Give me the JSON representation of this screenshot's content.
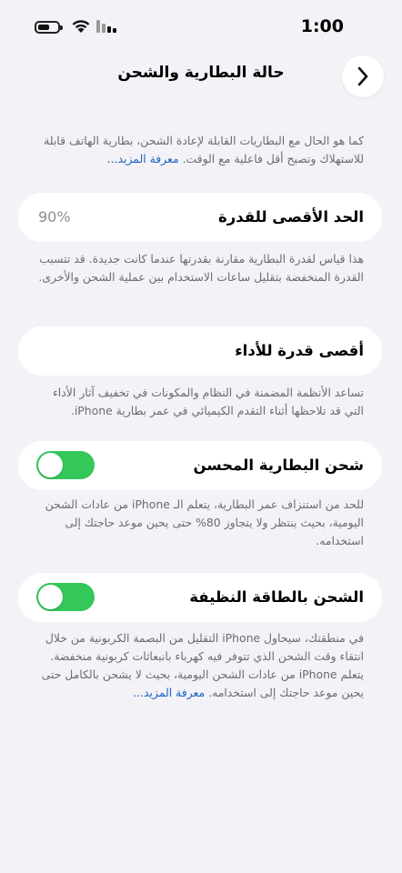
{
  "status": {
    "time": "1:00",
    "battery_level": 0.62,
    "icons": [
      "battery-icon",
      "wifi-icon",
      "cellular-signal-icon"
    ]
  },
  "nav": {
    "title": "حالة البطارية والشحن",
    "back_icon": "chevron-right-icon"
  },
  "intro": {
    "text": "كما هو الحال مع البطاريات القابلة لإعادة الشحن، بطارية الهاتف قابلة للاستهلاك وتصبح أقل فاعلية مع الوقت.",
    "link": "معرفة المزيد..."
  },
  "max_capacity": {
    "label": "الحد الأقصى للقدرة",
    "value": "90%",
    "note": "هذا قياس لقدرة البطارية مقارنة بقدرتها عندما كانت جديدة. قد تتسبب القدرة المنخفضة بتقليل ساعات الاستخدام بين عملية الشحن والأخرى."
  },
  "peak_performance": {
    "label": "أقصى قدرة للأداء",
    "note": "تساعد الأنظمة المضمنة في النظام والمكونات في تخفيف آثار الأداء التي قد تلاحظها أثناء التقدم الكيميائي في عمر بطارية iPhone."
  },
  "optimized_charging": {
    "label": "شحن البطارية المحسن",
    "enabled": true,
    "note": "للحد من استنزاف عمر البطارية، يتعلم الـ iPhone من عادات الشحن اليومية، بحيث ينتظر ولا يتجاوز 80% حتى يحين موعد حاجتك إلى استخدامه."
  },
  "clean_energy": {
    "label": "الشحن بالطاقة النظيفة",
    "enabled": true,
    "note": "في منطقتك، سيحاول iPhone التقليل من البصمة الكربونية من خلال انتقاء وقت الشحن الذي تتوفر فيه كهرباء بانبعاثات كربونية منخفضة. يتعلم iPhone من عادات الشحن اليومية، بحيث لا يشحن بالكامل حتى يحين موعد حاجتك إلى استخدامه.",
    "link": "معرفة المزيد..."
  },
  "colors": {
    "background": "#f2f2f7",
    "toggle_on": "#34c759",
    "link": "#1e63c4",
    "secondary_text": "#6c6c70"
  }
}
